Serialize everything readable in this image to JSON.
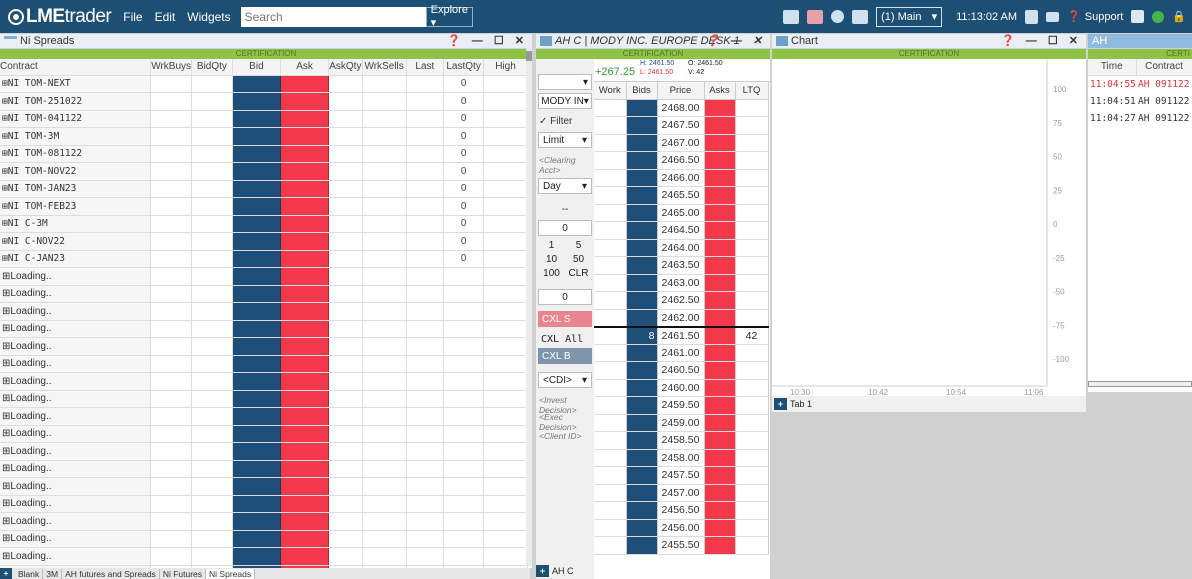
{
  "topbar": {
    "brand": "LME",
    "brand_suffix": "trader",
    "menu": [
      "File",
      "Edit",
      "Widgets"
    ],
    "search_placeholder": "Search",
    "explore_label": "Explore ▾",
    "workspace": "(1) Main",
    "clock": "11:13:02 AM",
    "support_label": "Support"
  },
  "spreads": {
    "title": "Ni Spreads",
    "cert": "CERTIFICATION",
    "columns": [
      "Contract",
      "WrkBuys",
      "BidQty",
      "Bid",
      "Ask",
      "AskQty",
      "WrkSells",
      "Last",
      "LastQty",
      "High"
    ],
    "rows": [
      {
        "contract": "⊞NI TOM-NEXT",
        "lastqty": "0"
      },
      {
        "contract": "⊞NI TOM-251022",
        "lastqty": "0"
      },
      {
        "contract": "⊞NI TOM-041122",
        "lastqty": "0"
      },
      {
        "contract": "⊞NI TOM-3M",
        "lastqty": "0"
      },
      {
        "contract": "⊞NI TOM-081122",
        "lastqty": "0"
      },
      {
        "contract": "⊞NI TOM-NOV22",
        "lastqty": "0"
      },
      {
        "contract": "⊞NI TOM-JAN23",
        "lastqty": "0"
      },
      {
        "contract": "⊞NI TOM-FEB23",
        "lastqty": "0"
      },
      {
        "contract": "⊞NI C-3M",
        "lastqty": "0"
      },
      {
        "contract": "⊞NI C-NOV22",
        "lastqty": "0"
      },
      {
        "contract": "⊞NI C-JAN23",
        "lastqty": "0"
      },
      {
        "contract": "⊞Loading..",
        "lastqty": ""
      },
      {
        "contract": "⊞Loading..",
        "lastqty": ""
      },
      {
        "contract": "⊞Loading..",
        "lastqty": ""
      },
      {
        "contract": "⊞Loading..",
        "lastqty": ""
      },
      {
        "contract": "⊞Loading..",
        "lastqty": ""
      },
      {
        "contract": "⊞Loading..",
        "lastqty": ""
      },
      {
        "contract": "⊞Loading..",
        "lastqty": ""
      },
      {
        "contract": "⊞Loading..",
        "lastqty": ""
      },
      {
        "contract": "⊞Loading..",
        "lastqty": ""
      },
      {
        "contract": "⊞Loading..",
        "lastqty": ""
      },
      {
        "contract": "⊞Loading..",
        "lastqty": ""
      },
      {
        "contract": "⊞Loading..",
        "lastqty": ""
      },
      {
        "contract": "⊞Loading..",
        "lastqty": ""
      },
      {
        "contract": "⊞Loading..",
        "lastqty": ""
      },
      {
        "contract": "⊞Loading..",
        "lastqty": ""
      },
      {
        "contract": "⊞Loading..",
        "lastqty": ""
      },
      {
        "contract": "⊞Loading..",
        "lastqty": ""
      },
      {
        "contract": "⊞Loading..",
        "lastqty": ""
      }
    ],
    "tabs": [
      "Blank",
      "3M",
      "AH futures and Spreads",
      "Ni Futures",
      "Ni Spreads"
    ],
    "selected_tab": "Ni Spreads"
  },
  "ladder": {
    "title": "AH C | MODY INC. EUROPE DESK 1",
    "cert": "CERTIFICATION",
    "change": "+267.25",
    "hi": "H: 2461.50",
    "lo": "L: 2461.50",
    "open": "O: 2461.50",
    "vol": "V: 42",
    "columns": [
      "Work",
      "Bids",
      "Price",
      "Asks",
      "LTQ"
    ],
    "prices": [
      "2468.00",
      "2467.50",
      "2467.00",
      "2466.50",
      "2466.00",
      "2465.50",
      "2465.00",
      "2464.50",
      "2464.00",
      "2463.50",
      "2463.00",
      "2462.50",
      "2462.00",
      "2461.50",
      "2461.00",
      "2460.50",
      "2460.00",
      "2459.50",
      "2459.00",
      "2458.50",
      "2458.00",
      "2457.50",
      "2457.00",
      "2456.50",
      "2456.00",
      "2455.50"
    ],
    "last_price": "2461.50",
    "last_bid_qty": "8",
    "last_ltq": "42",
    "account_select": "MODY IN▾",
    "filter_label": "✓ Filter",
    "order_type": "Limit",
    "clearing_placeholder": "<Clearing Acct>",
    "tif": "Day",
    "price_box": "--",
    "qty_box": "0",
    "qty_buttons": [
      "1",
      "5",
      "10",
      "50",
      "100",
      "CLR"
    ],
    "qty_box2": "0",
    "cxl_s": "CXL S",
    "cxl_all": "CXL All",
    "cxl_b": "CXL B",
    "cdi": "<CDI>",
    "invest_placeholder": "<Invest Decision>",
    "exec_placeholder": "<Exec Decision>",
    "client_placeholder": "<Client ID>",
    "tab": "AH C"
  },
  "chart": {
    "title": "Chart",
    "cert": "CERTIFICATION",
    "y_ticks": [
      "100",
      "75",
      "50",
      "25",
      "0",
      "-25",
      "-50",
      "-75",
      "-100"
    ],
    "x_ticks": [
      "10:30",
      "10:42",
      "10:54",
      "11:06"
    ],
    "tab": "Tab 1"
  },
  "ah": {
    "title": "AH",
    "cert": "CERTI",
    "columns": [
      "Time",
      "Contract"
    ],
    "rows": [
      {
        "time": "11:04:55",
        "contract": "AH 091122",
        "highlight": true
      },
      {
        "time": "11:04:51",
        "contract": "AH 091122",
        "highlight": false
      },
      {
        "time": "11:04:27",
        "contract": "AH 091122",
        "highlight": false
      }
    ]
  },
  "colors": {
    "topbar": "#1d4f74",
    "cert": "#8ec348",
    "bid": "#1f4e79",
    "ask": "#f2384b",
    "positive": "#2f9e3a",
    "highlight": "#e0303c"
  }
}
